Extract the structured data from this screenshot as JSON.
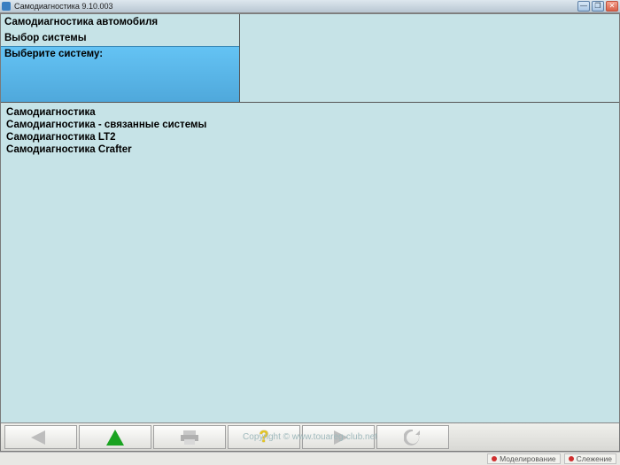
{
  "window": {
    "title": "Самодиагностика 9.10.003"
  },
  "upper": {
    "heading1": "Самодиагностика автомобиля",
    "heading2": "Выбор системы",
    "prompt": "Выберите систему:"
  },
  "menu": {
    "items": [
      {
        "label": "Самодиагностика"
      },
      {
        "label": "Самодиагностика - связанные системы"
      },
      {
        "label": "Самодиагностика LT2"
      },
      {
        "label": "Самодиагностика Crafter"
      }
    ]
  },
  "watermark": "Copyright © www.touareg-club.net",
  "status": {
    "seg1": "Моделирование",
    "seg2": "Слежение"
  }
}
